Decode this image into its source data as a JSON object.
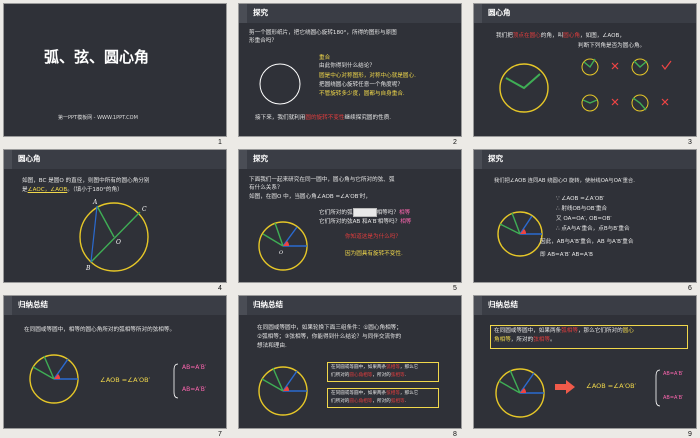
{
  "slides": [
    {
      "title": "弧、弦、圆心角",
      "footer": "第一PPT模板网 - WWW.1PPT.COM",
      "num": "1"
    },
    {
      "title": "探究",
      "q": "剪一个圆形纸片，把它绕圆心旋转180°，所得的图形与原图",
      "q2": "形重合吗？",
      "ans1": "重合",
      "ans2": "由此你得到什么结论？",
      "ans3": "圆是中心对称图形，对称中心就是圆心.",
      "ans4": "把圆绕圆心旋转任意一个角度呢？",
      "ans5": "不管旋转多少度，圆都与自身重合.",
      "bottom1": "接下来，我们就利用",
      "bottom_r": "圆的旋转不变性",
      "bottom2": "继续探究圆的性质.",
      "num": "2"
    },
    {
      "title": "圆心角",
      "l1a": "我们把",
      "l1r": "顶点在圆心",
      "l1b": "的角，叫",
      "l1c": "圆心角",
      "l1d": "，如图，∠AOB，",
      "l2": "判断下列角是否为圆心角。",
      "num": "3"
    },
    {
      "title": "圆心角",
      "l1": "如图，BC 是圆O 的直径，则图中所有的圆心角分别",
      "l2a": "是",
      "l2y": "∠AOC，∠AOB",
      "l2b": "。（填小于180°的角）",
      "num": "4"
    },
    {
      "title": "探究",
      "l1": "下面我们一起来研究在同一圆中，圆心角与它所对的弦、弧",
      "l2": "有什么关系？",
      "l3": "如图，在圆O 中，当圆心角∠AOB =∠A′OB′时，",
      "l4a": "它们所对的弧",
      "l4b": "相等吗？",
      "l4c": "相等",
      "l5a": "它们所对的弦AB 和A′B′相等吗？",
      "l5b": "相等",
      "l6": "你知道这是为什么吗？",
      "l7": "因为圆具有旋转不变性.",
      "num": "5"
    },
    {
      "title": "探究",
      "l1": "我们把∠AOB 连同AB 绕圆心O 旋转，使射线OA与OA′重合.",
      "l2": "∵ ∠AOB =∠A′OB′",
      "l3": "∴ 射线OB与OB′重合",
      "l4": "又  OA=OA′, OB=OB′",
      "l5": "∴ 点A与A′重合，点B与B′重合",
      "l6": "因此，AB与A′B′重合，AB 与A′B′重合",
      "l7": "即 AB=A′B′  AB=A′B",
      "num": "6"
    },
    {
      "title": "归纳总结",
      "l1": "在同圆或等圆中，相等的圆心角所对的弧相等所对的弦相等。",
      "eq": "∠AOB =∠A′OB′",
      "r1": "AB=A′B′",
      "r2": "AB=A′B′",
      "num": "7"
    },
    {
      "title": "归纳总结",
      "l1": "在同圆或等圆中，如果轮换下面三组条件：①圆心角相等；",
      "l2": "②弧相等；③弦相等，你能得到什么结论？与同伴交流你的",
      "l3": "想法和理由.",
      "b1a": "在同圆或等圆中，如果两条",
      "b1b": "弧相等",
      "b1c": "，那么它",
      "b1d": "们所对的",
      "b1e": "圆心角相等",
      "b1f": "，所对的",
      "b1g": "弦相等",
      "b1h": ".",
      "b2a": "在同圆或等圆中，如果两条",
      "b2b": "弦相等",
      "b2c": "，那么它",
      "b2d": "们所对的",
      "b2e": "圆心角相等",
      "b2f": "，所对的",
      "b2g": "弧相等",
      "b2h": ".",
      "num": "8"
    },
    {
      "title": "归纳总结",
      "l1a": "在同圆或等圆中，如果两条",
      "l1r": "弧相等",
      "l1b": "，那么它们所对的",
      "l1y": "圆心",
      "l2y": "角相等",
      "l2a": "，所对的",
      "l2r": "弦相等",
      "l2b": "。",
      "eq": "∠AOB =∠A′OB′",
      "r1": "AB=A′B′",
      "r2": "AB=A′B′",
      "num": "9"
    }
  ]
}
